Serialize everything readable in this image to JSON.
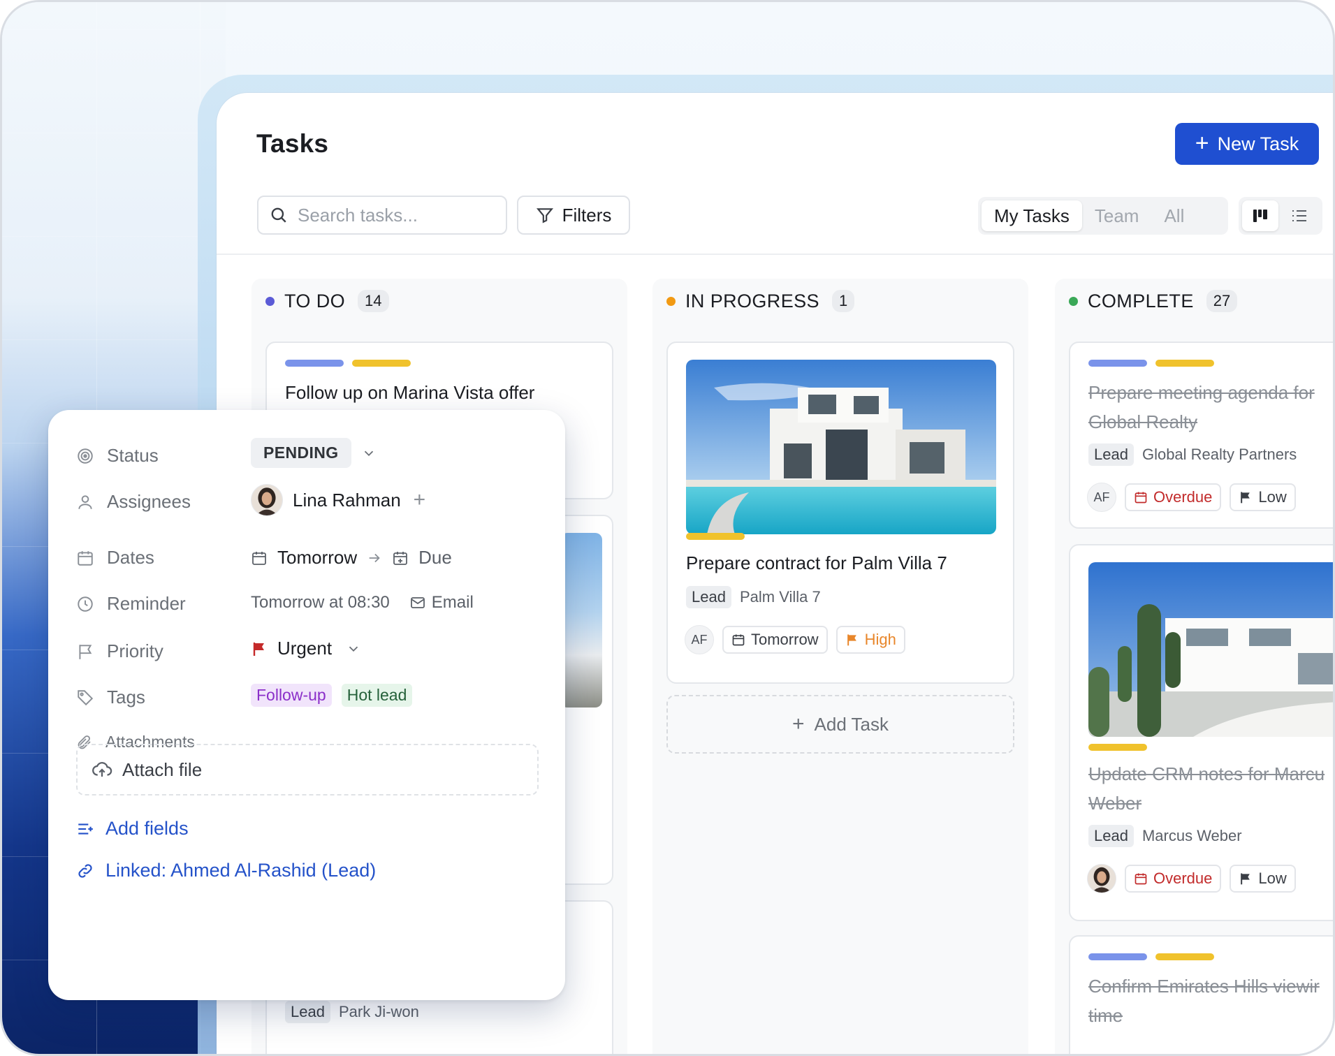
{
  "header": {
    "title": "Tasks",
    "new_task_label": "New Task",
    "search_placeholder": "Search tasks...",
    "filters_label": "Filters",
    "scope_tabs": [
      "My Tasks",
      "Team",
      "All"
    ]
  },
  "columns": [
    {
      "name": "TO DO",
      "count": "14",
      "color": "#5b5bd6"
    },
    {
      "name": "IN PROGRESS",
      "count": "1",
      "color": "#f29a13"
    },
    {
      "name": "COMPLETE",
      "count": "27",
      "color": "#3aa857"
    }
  ],
  "todo_cards": [
    {
      "title": "Follow up on Marina Vista offer"
    },
    {
      "lead_label": "Lead",
      "lead_name": "Park Ji-won"
    }
  ],
  "progress_card": {
    "title": "Prepare contract for Palm Villa 7",
    "lead_label": "Lead",
    "lead_name": "Palm Villa 7",
    "assignee": "AF",
    "date": "Tomorrow",
    "priority": "High"
  },
  "add_task_label": "Add Task",
  "complete_cards": [
    {
      "title_line1": "Prepare meeting agenda for",
      "title_line2": "Global Realty",
      "lead_label": "Lead",
      "lead_name": "Global Realty Partners",
      "assignee": "AF",
      "date": "Overdue",
      "priority": "Low"
    },
    {
      "title_line1": "Update CRM notes for Marcu",
      "title_line2": "Weber",
      "lead_label": "Lead",
      "lead_name": "Marcus Weber",
      "date": "Overdue",
      "priority": "Low"
    },
    {
      "title_line1": "Confirm Emirates Hills viewir",
      "title_line2": "time"
    }
  ],
  "panel": {
    "status_label": "Status",
    "status_value": "PENDING",
    "assignees_label": "Assignees",
    "assignee_name": "Lina Rahman",
    "dates_label": "Dates",
    "start_date": "Tomorrow",
    "due_date": "Due",
    "reminder_label": "Reminder",
    "reminder_value": "Tomorrow at 08:30",
    "reminder_channel": "Email",
    "priority_label": "Priority",
    "priority_value": "Urgent",
    "tags_label": "Tags",
    "tags": [
      "Follow-up",
      "Hot lead"
    ],
    "attachments_label": "Attachments",
    "attach_label": "Attach file",
    "add_fields_label": "Add fields",
    "linked_label": "Linked: Ahmed Al-Rashid (Lead)"
  },
  "colors": {
    "primary": "#1f4fd1",
    "overdue": "#c22b2b",
    "high": "#e8862a",
    "urgent_flag": "#c42a2a",
    "link": "#2452c9"
  }
}
